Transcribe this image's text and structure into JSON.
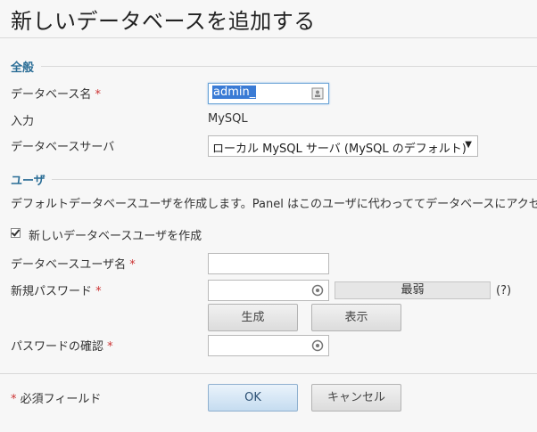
{
  "page": {
    "title": "新しいデータベースを追加する"
  },
  "general": {
    "heading": "全般",
    "db_name_label": "データベース名",
    "db_name_value": "admin_",
    "type_label": "入力",
    "type_value": "MySQL",
    "server_label": "データベースサーバ",
    "server_value": "ローカル MySQL サーバ (MySQL のデフォルト)"
  },
  "users": {
    "heading": "ユーザ",
    "description": "デフォルトデータベースユーザを作成します。Panel はこのユーザに代わっててデータベースにアクセス",
    "create_checkbox_label": "新しいデータベースユーザを作成",
    "username_label": "データベースユーザ名",
    "password_label": "新規パスワード",
    "strength_text": "最弱",
    "help_text": "(?)",
    "generate_label": "生成",
    "show_label": "表示",
    "confirm_label": "パスワードの確認"
  },
  "footer": {
    "required_note": "必須フィールド",
    "ok_label": "OK",
    "cancel_label": "キャンセル"
  },
  "required_mark": "*"
}
